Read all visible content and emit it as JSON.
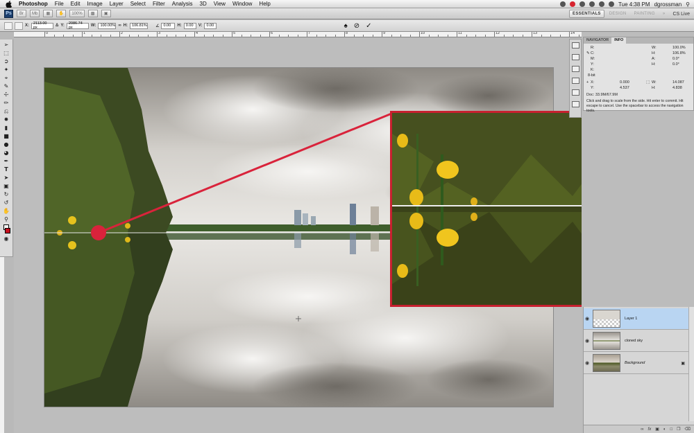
{
  "menubar": {
    "app_name": "Photoshop",
    "items": [
      "File",
      "Edit",
      "Image",
      "Layer",
      "Select",
      "Filter",
      "Analysis",
      "3D",
      "View",
      "Window",
      "Help"
    ],
    "clock": "Tue 4:38 PM",
    "user": "dgrossman"
  },
  "appbar": {
    "logo": "Ps",
    "zoom": "100%",
    "workspaces": [
      "ESSENTIALS",
      "DESIGN",
      "PAINTING"
    ],
    "cs_live": "CS Live"
  },
  "options": {
    "x_label": "X:",
    "x_value": "2113.00 px",
    "y_label": "Y:",
    "y_value": "2086.74 px",
    "w_label": "W:",
    "w_value": "100.00%",
    "h_label": "H:",
    "h_value": "106.81%",
    "angle_value": "0.00",
    "hskew_label": "H:",
    "hskew_value": "0.00",
    "vskew_label": "V:",
    "vskew_value": "0.00"
  },
  "ruler": {
    "labels": [
      "0",
      "1",
      "2",
      "3",
      "4",
      "5",
      "6",
      "7",
      "8",
      "9",
      "10",
      "11",
      "12",
      "13",
      "14"
    ]
  },
  "info_panel": {
    "tabs": [
      "NAVIGATOR",
      "INFO"
    ],
    "r_label": "R:",
    "c_label": "C:",
    "m_label": "M:",
    "y_label": "Y:",
    "k_label": "K:",
    "w1_label": "W:",
    "w1_value": "100.0%",
    "h1_label": "H:",
    "h1_value": "106.8%",
    "a_label": "A:",
    "a_value": "0.0°",
    "h2_label": "H:",
    "h2_value": "0.0°",
    "bit_label": "8-bit",
    "x_label": "X:",
    "x_value": "0.000",
    "y2_label": "Y:",
    "y2_value": "4.537",
    "w2_label": "W:",
    "w2_value": "14.087",
    "h3_label": "H:",
    "h3_value": "4.838",
    "doc": "Doc: 33.9M/67.9M",
    "hint": "Click and drag to scale from the side. Hit enter to commit. Hit escape to cancel. Use the spacebar to access the navigation tools."
  },
  "layers": [
    {
      "name": "Layer 1",
      "selected": true,
      "italic": false
    },
    {
      "name": "cloned sky",
      "selected": false,
      "italic": false
    },
    {
      "name": "Background",
      "selected": false,
      "italic": true
    }
  ],
  "colors": {
    "highlight": "#c8202f",
    "selection": "#b9d5f2"
  }
}
